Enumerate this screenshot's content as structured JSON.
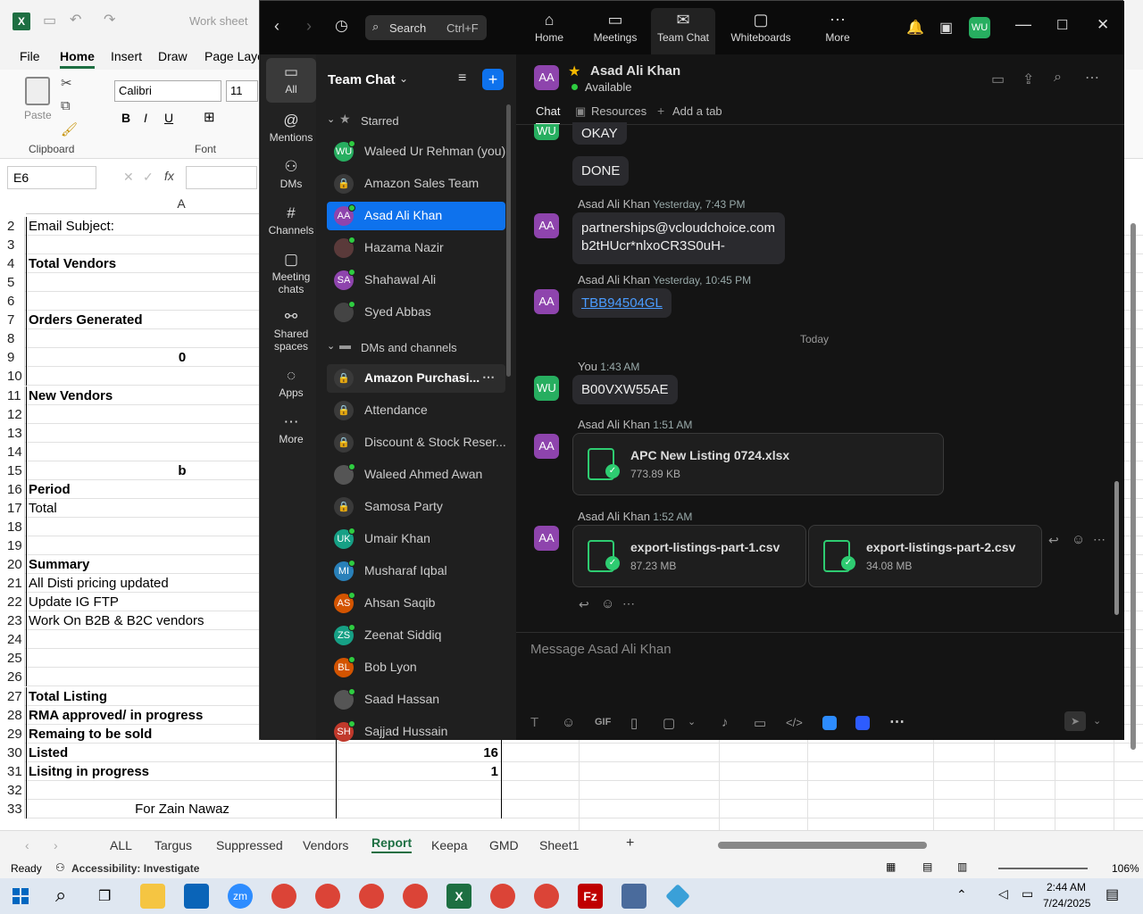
{
  "excel": {
    "title": "Work sheet",
    "tabs": [
      "File",
      "Home",
      "Insert",
      "Draw",
      "Page Layo"
    ],
    "clipboard": {
      "paste": "Paste",
      "group": "Clipboard"
    },
    "font": {
      "name": "Calibri",
      "size": "11",
      "group": "Font"
    },
    "name_box": "E6",
    "column_a": "A",
    "rows": [
      {
        "n": "2",
        "a": "Email Subject:",
        "b": "",
        "bold": false,
        "center": false
      },
      {
        "n": "3",
        "a": "",
        "b": "",
        "bold": false,
        "center": false
      },
      {
        "n": "4",
        "a": "Total Vendors",
        "b": "",
        "bold": true,
        "center": false
      },
      {
        "n": "5",
        "a": "",
        "b": "",
        "bold": false,
        "center": false
      },
      {
        "n": "6",
        "a": "",
        "b": "",
        "bold": false,
        "center": false
      },
      {
        "n": "7",
        "a": "Orders Generated",
        "b": "",
        "bold": true,
        "center": false
      },
      {
        "n": "8",
        "a": "",
        "b": "",
        "bold": false,
        "center": false
      },
      {
        "n": "9",
        "a": "0",
        "b": "",
        "bold": true,
        "center": true
      },
      {
        "n": "10",
        "a": "",
        "b": "",
        "bold": false,
        "center": false
      },
      {
        "n": "11",
        "a": "New Vendors",
        "b": "",
        "bold": true,
        "center": false
      },
      {
        "n": "12",
        "a": "",
        "b": "",
        "bold": false,
        "center": false
      },
      {
        "n": "13",
        "a": "",
        "b": "",
        "bold": false,
        "center": false
      },
      {
        "n": "14",
        "a": "",
        "b": "",
        "bold": false,
        "center": false
      },
      {
        "n": "15",
        "a": "b",
        "b": "",
        "bold": true,
        "center": true
      },
      {
        "n": "16",
        "a": "Period",
        "b": "",
        "bold": true,
        "center": false
      },
      {
        "n": "17",
        "a": "Total",
        "b": "",
        "bold": false,
        "center": false
      },
      {
        "n": "18",
        "a": "",
        "b": "",
        "bold": false,
        "center": false
      },
      {
        "n": "19",
        "a": "",
        "b": "",
        "bold": false,
        "center": false
      },
      {
        "n": "20",
        "a": "Summary",
        "b": "",
        "bold": true,
        "center": false
      },
      {
        "n": "21",
        "a": "All Disti pricing updated",
        "b": "",
        "bold": false,
        "center": false
      },
      {
        "n": "22",
        "a": "Update IG FTP",
        "b": "",
        "bold": false,
        "center": false
      },
      {
        "n": "23",
        "a": "Work On B2B & B2C vendors",
        "b": "",
        "bold": false,
        "center": false
      },
      {
        "n": "24",
        "a": "",
        "b": "",
        "bold": false,
        "center": false
      },
      {
        "n": "25",
        "a": "",
        "b": "",
        "bold": false,
        "center": false
      },
      {
        "n": "26",
        "a": "",
        "b": "",
        "bold": false,
        "center": false
      },
      {
        "n": "27",
        "a": "Total Listing",
        "b": "",
        "bold": true,
        "center": false
      },
      {
        "n": "28",
        "a": "RMA approved/ in progress",
        "b": "",
        "bold": true,
        "center": false
      },
      {
        "n": "29",
        "a": "Remaing to be sold",
        "b": "",
        "bold": true,
        "center": false
      },
      {
        "n": "30",
        "a": "Listed",
        "b": "16",
        "bold": true,
        "center": false
      },
      {
        "n": "31",
        "a": "Lisitng in progress",
        "b": "1",
        "bold": true,
        "center": false
      },
      {
        "n": "32",
        "a": "",
        "b": "",
        "bold": false,
        "center": false
      },
      {
        "n": "33",
        "a": "For Zain Nawaz",
        "b": "",
        "bold": false,
        "center": true
      }
    ],
    "sheets": [
      "ALL",
      "Targus",
      "Suppressed",
      "Vendors",
      "Report",
      "Keepa",
      "GMD",
      "Sheet1"
    ],
    "active_sheet": "Report",
    "status_ready": "Ready",
    "status_accessibility": "Accessibility: Investigate",
    "zoom": "106%"
  },
  "zoom_app": {
    "search": "Search",
    "search_shortcut": "Ctrl+F",
    "top_nav": [
      {
        "label": "Home",
        "icon": "home-icon"
      },
      {
        "label": "Meetings",
        "icon": "video-icon"
      },
      {
        "label": "Team Chat",
        "icon": "chat-icon"
      },
      {
        "label": "Whiteboards",
        "icon": "whiteboard-icon"
      },
      {
        "label": "More",
        "icon": "more-icon"
      }
    ],
    "user_initials": "WU",
    "left_nav": [
      "All",
      "Mentions",
      "DMs",
      "Channels",
      "Meeting chats",
      "Shared spaces",
      "Apps",
      "More"
    ],
    "list_title": "Team Chat",
    "starred_label": "Starred",
    "dms_label": "DMs and channels",
    "starred": [
      {
        "name": "Waleed Ur Rehman (you)",
        "initials": "WU",
        "color": "#27ae60",
        "type": "avatar"
      },
      {
        "name": "Amazon Sales Team",
        "initials": "",
        "color": "",
        "type": "lock"
      },
      {
        "name": "Asad Ali Khan",
        "initials": "AA",
        "color": "#8e44ad",
        "type": "avatar"
      },
      {
        "name": "Hazama Nazir",
        "initials": "",
        "color": "#5a3a3a",
        "type": "avatar"
      },
      {
        "name": "Shahawal Ali",
        "initials": "SA",
        "color": "#8e44ad",
        "type": "avatar"
      },
      {
        "name": "Syed Abbas",
        "initials": "",
        "color": "#444",
        "type": "avatar"
      }
    ],
    "channels": [
      {
        "name": "Amazon Purchasi...",
        "initials": "",
        "color": "",
        "type": "lock"
      },
      {
        "name": "Attendance",
        "initials": "",
        "color": "",
        "type": "lock"
      },
      {
        "name": "Discount & Stock Reser...",
        "initials": "",
        "color": "",
        "type": "lock"
      },
      {
        "name": "Waleed Ahmed Awan",
        "initials": "",
        "color": "#555",
        "type": "avatar"
      },
      {
        "name": "Samosa Party",
        "initials": "",
        "color": "",
        "type": "lock"
      },
      {
        "name": "Umair Khan",
        "initials": "UK",
        "color": "#16a085",
        "type": "avatar"
      },
      {
        "name": "Musharaf Iqbal",
        "initials": "MI",
        "color": "#2980b9",
        "type": "avatar"
      },
      {
        "name": "Ahsan Saqib",
        "initials": "AS",
        "color": "#d35400",
        "type": "avatar"
      },
      {
        "name": "Zeenat Siddiq",
        "initials": "ZS",
        "color": "#16a085",
        "type": "avatar"
      },
      {
        "name": "Bob Lyon",
        "initials": "BL",
        "color": "#d35400",
        "type": "avatar"
      },
      {
        "name": "Saad Hassan",
        "initials": "",
        "color": "#555",
        "type": "avatar"
      },
      {
        "name": "Sajjad Hussain",
        "initials": "SH",
        "color": "#c0392b",
        "type": "avatar"
      }
    ],
    "chat": {
      "name": "Asad Ali Khan",
      "initials": "AA",
      "status": "Available",
      "tabs": [
        "Chat",
        "Resources",
        "Add a tab"
      ],
      "msg_okay": "OKAY",
      "msg_done": "DONE",
      "m1_sender": "Asad Ali Khan",
      "m1_time": "Yesterday, 7:43 PM",
      "m1_line1": "partnerships@vcloudchoice.com",
      "m1_line2": "b2tHUcr*nlxoCR3S0uH-",
      "m2_sender": "Asad Ali Khan",
      "m2_time": "Yesterday, 10:45 PM",
      "m2_link": "TBB94504GL",
      "day_divider": "Today",
      "m3_sender": "You",
      "m3_time": "1:43 AM",
      "m3_text": "B00VXW55AE",
      "m4_sender": "Asad Ali Khan",
      "m4_time": "1:51 AM",
      "m4_file": "APC New Listing 0724.xlsx",
      "m4_size": "773.89 KB",
      "m5_sender": "Asad Ali Khan",
      "m5_time": "1:52 AM",
      "m5_file1": "export-listings-part-1.csv",
      "m5_size1": "87.23 MB",
      "m5_file2": "export-listings-part-2.csv",
      "m5_size2": "34.08 MB",
      "composer_placeholder": "Message Asad Ali Khan"
    }
  },
  "taskbar": {
    "time": "2:44 AM",
    "date": "7/24/2025"
  }
}
